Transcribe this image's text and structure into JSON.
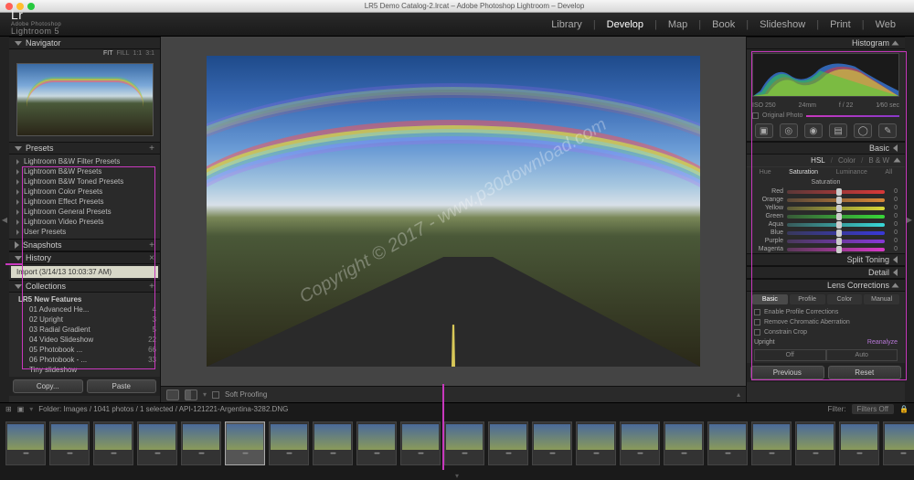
{
  "window": {
    "title": "LR5 Demo Catalog-2.lrcat – Adobe Photoshop Lightroom – Develop"
  },
  "app": {
    "logo_prefix": "Lr",
    "logo_sub": "Adobe Photoshop",
    "logo_name": "Lightroom 5"
  },
  "modules": [
    "Library",
    "Develop",
    "Map",
    "Book",
    "Slideshow",
    "Print",
    "Web"
  ],
  "active_module": "Develop",
  "navigator": {
    "title": "Navigator",
    "zoom_opts": [
      "FIT",
      "FILL",
      "1:1",
      "3:1"
    ],
    "active_zoom": "FIT"
  },
  "presets": {
    "title": "Presets",
    "items": [
      "Lightroom B&W Filter Presets",
      "Lightroom B&W Presets",
      "Lightroom B&W Toned Presets",
      "Lightroom Color Presets",
      "Lightroom Effect Presets",
      "Lightroom General Presets",
      "Lightroom Video Presets",
      "User Presets"
    ]
  },
  "snapshots": {
    "title": "Snapshots"
  },
  "history": {
    "title": "History",
    "entry": "Import (3/14/13 10:03:37 AM)"
  },
  "collections": {
    "title": "Collections",
    "group": "LR5 New Features",
    "items": [
      {
        "name": "01 Advanced He...",
        "count": "4"
      },
      {
        "name": "02 Upright",
        "count": "3"
      },
      {
        "name": "03 Radial Gradient",
        "count": "5"
      },
      {
        "name": "04 Video Slideshow",
        "count": "22"
      },
      {
        "name": "05 Photobook ...",
        "count": "66"
      },
      {
        "name": "06 Photobook - ...",
        "count": "33"
      },
      {
        "name": "Tiny slideshow",
        "count": ""
      }
    ]
  },
  "left_buttons": {
    "copy": "Copy...",
    "paste": "Paste"
  },
  "histogram": {
    "title": "Histogram",
    "iso": "ISO 250",
    "focal": "24mm",
    "aperture": "f / 22",
    "shutter": "1⁄60 sec",
    "orig": "Original Photo"
  },
  "right_panels": {
    "basic": "Basic",
    "hsl": {
      "label": "HSL",
      "color": "Color",
      "bw": "B & W",
      "all": "All"
    },
    "subtabs": [
      "Hue",
      "Saturation",
      "Luminance",
      "All"
    ],
    "active_sub": "Saturation",
    "sat_label": "Saturation",
    "colors": [
      "Red",
      "Orange",
      "Yellow",
      "Green",
      "Aqua",
      "Blue",
      "Purple",
      "Magenta"
    ],
    "split": "Split Toning",
    "detail": "Detail",
    "lens": {
      "title": "Lens Corrections",
      "tabs": [
        "Basic",
        "Profile",
        "Color",
        "Manual"
      ],
      "checks": [
        "Enable Profile Corrections",
        "Remove Chromatic Aberration",
        "Constrain Crop"
      ],
      "upright": "Upright",
      "reanalyze": "Reanalyze",
      "off": "Off",
      "auto": "Auto"
    }
  },
  "right_buttons": {
    "prev": "Previous",
    "reset": "Reset"
  },
  "toolbar": {
    "softproof": "Soft Proofing"
  },
  "filmstrip_bar": {
    "path": "Folder: Images / 1041 photos / 1 selected / API-121221-Argentina-3282.DNG",
    "filter": "Filter:",
    "filters_off": "Filters Off"
  },
  "watermark": "Copyright © 2017 - www.p30download.com",
  "thumb_count": 21,
  "selected_thumb": 5
}
